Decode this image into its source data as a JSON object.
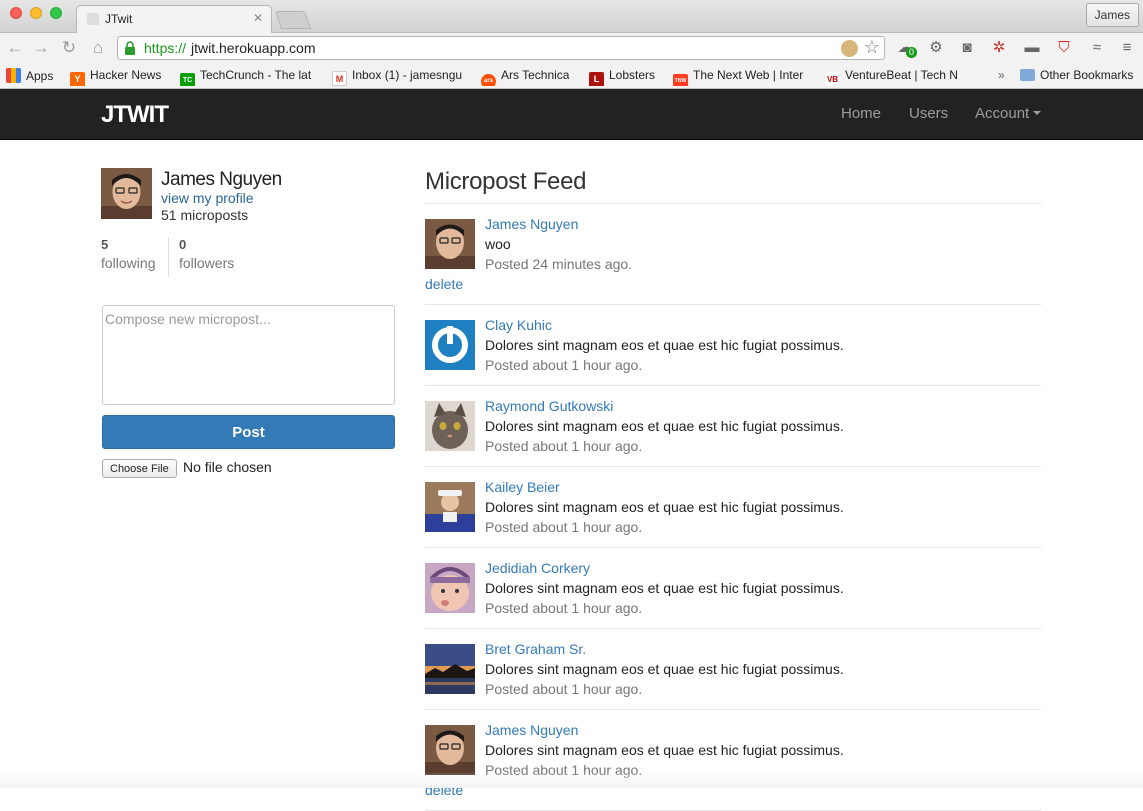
{
  "browser": {
    "tab_title": "JTwit",
    "profile_name": "James",
    "url_scheme": "https://",
    "url_host": "jtwit.herokuapp.com",
    "bookmarks": [
      {
        "label": "Apps",
        "icon": "apps-grid-icon",
        "color": "#e8453c"
      },
      {
        "label": "Hacker News",
        "icon": "hacker-news-icon",
        "color": "#ff6600",
        "glyph": "Y"
      },
      {
        "label": "TechCrunch - The lat",
        "icon": "techcrunch-icon",
        "color": "#0a9e01",
        "glyph": "TC"
      },
      {
        "label": "Inbox (1) - jamesngu",
        "icon": "gmail-icon",
        "color": "#ffffff",
        "glyph": "M"
      },
      {
        "label": "Ars Technica",
        "icon": "ars-technica-icon",
        "color": "#ff4e00",
        "glyph": "ars"
      },
      {
        "label": "Lobsters",
        "icon": "lobsters-icon",
        "color": "#ac130d",
        "glyph": "L"
      },
      {
        "label": "The Next Web | Inter",
        "icon": "tnw-icon",
        "color": "#ff3c1f",
        "glyph": "TNW"
      },
      {
        "label": "VentureBeat | Tech N",
        "icon": "venturebeat-icon",
        "color": "#ffffff",
        "glyph": "VB"
      }
    ],
    "overflow": "»",
    "other_bookmarks": "Other Bookmarks",
    "ext_badge": "0"
  },
  "nav": {
    "brand": "JTWIT",
    "home": "Home",
    "users": "Users",
    "account": "Account"
  },
  "profile": {
    "name": "James Nguyen",
    "view_link": "view my profile",
    "microposts": "51 microposts",
    "following_count": "5",
    "following_label": "following",
    "followers_count": "0",
    "followers_label": "followers"
  },
  "compose": {
    "placeholder": "Compose new micropost...",
    "post_label": "Post",
    "file_button": "Choose File",
    "file_status": "No file chosen"
  },
  "feed": {
    "title": "Micropost Feed",
    "delete_label": "delete",
    "posts": [
      {
        "user": "James Nguyen",
        "text": "woo",
        "time": "Posted 24 minutes ago.",
        "avatar": "james-avatar",
        "deletable": true
      },
      {
        "user": "Clay Kuhic",
        "text": "Dolores sint magnam eos et quae est hic fugiat possimus.",
        "time": "Posted about 1 hour ago.",
        "avatar": "gravatar-default-avatar",
        "deletable": false
      },
      {
        "user": "Raymond Gutkowski",
        "text": "Dolores sint magnam eos et quae est hic fugiat possimus.",
        "time": "Posted about 1 hour ago.",
        "avatar": "cat-avatar",
        "deletable": false
      },
      {
        "user": "Kailey Beier",
        "text": "Dolores sint magnam eos et quae est hic fugiat possimus.",
        "time": "Posted about 1 hour ago.",
        "avatar": "person-hat-avatar",
        "deletable": false
      },
      {
        "user": "Jedidiah Corkery",
        "text": "Dolores sint magnam eos et quae est hic fugiat possimus.",
        "time": "Posted about 1 hour ago.",
        "avatar": "baby-avatar",
        "deletable": false
      },
      {
        "user": "Bret Graham Sr.",
        "text": "Dolores sint magnam eos et quae est hic fugiat possimus.",
        "time": "Posted about 1 hour ago.",
        "avatar": "sunset-avatar",
        "deletable": false
      },
      {
        "user": "James Nguyen",
        "text": "Dolores sint magnam eos et quae est hic fugiat possimus.",
        "time": "Posted about 1 hour ago.",
        "avatar": "james-avatar",
        "deletable": true
      }
    ]
  },
  "colors": {
    "navbar": "#222222",
    "link": "#337ab7",
    "primary_button": "#337ab7",
    "url_secure": "#1a9a1a"
  }
}
